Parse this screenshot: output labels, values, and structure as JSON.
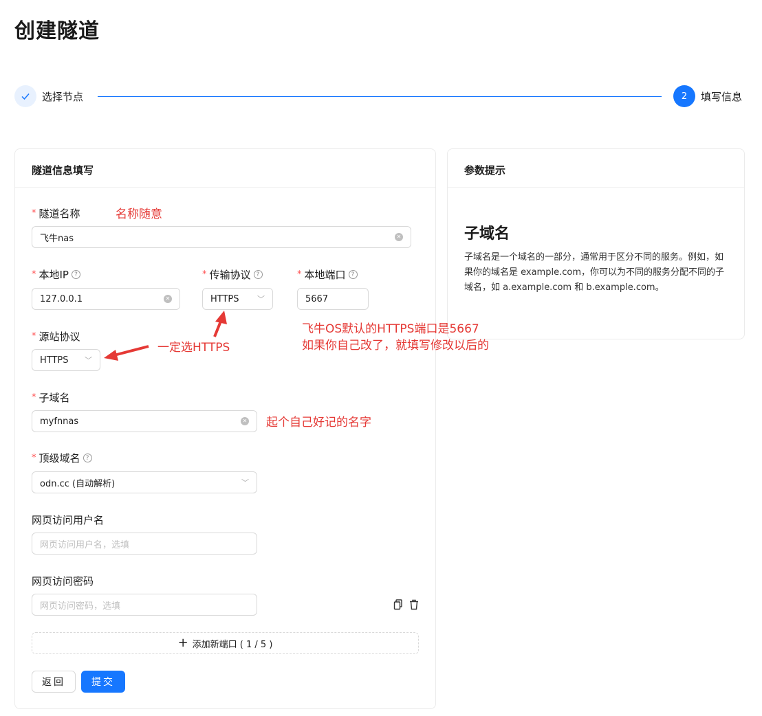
{
  "page": {
    "title": "创建隧道"
  },
  "steps": [
    {
      "label": "选择节点",
      "icon": "check-icon"
    },
    {
      "number": "2",
      "label": "填写信息"
    }
  ],
  "form_card": {
    "title": "隧道信息填写",
    "tunnel_name": {
      "label": "隧道名称",
      "value": "飞牛nas"
    },
    "local_ip": {
      "label": "本地IP",
      "value": "127.0.0.1"
    },
    "transport_protocol": {
      "label": "传输协议",
      "value": "HTTPS"
    },
    "local_port": {
      "label": "本地端口",
      "value": "5667"
    },
    "source_protocol": {
      "label": "源站协议",
      "value": "HTTPS"
    },
    "subdomain": {
      "label": "子域名",
      "value": "myfnnas"
    },
    "top_domain": {
      "label": "顶级域名",
      "value": "odn.cc (自动解析)"
    },
    "web_username": {
      "label": "网页访问用户名",
      "placeholder": "网页访问用户名，选填"
    },
    "web_password": {
      "label": "网页访问密码",
      "placeholder": "网页访问密码，选填"
    },
    "add_port_label": "添加新端口 ( 1 / 5 )",
    "back_button": "返回",
    "submit_button": "提交"
  },
  "hint_card": {
    "title": "参数提示",
    "heading": "子域名",
    "body": "子域名是一个域名的一部分，通常用于区分不同的服务。例如，如果你的域名是 example.com，你可以为不同的服务分配不同的子域名，如 a.example.com 和 b.example.com。"
  },
  "annotations": {
    "name_note": "名称随意",
    "https_note": "一定选HTTPS",
    "port_note_line1": "飞牛OS默认的HTTPS端口是5667",
    "port_note_line2": "如果你自己改了，就填写修改以后的",
    "subdomain_note": "起个自己好记的名字"
  },
  "colors": {
    "accent": "#1677ff",
    "annotation": "#e53935",
    "required": "#ff4d4f"
  }
}
